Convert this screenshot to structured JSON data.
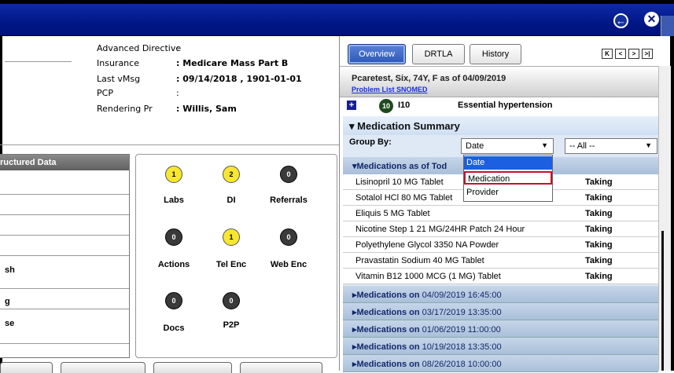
{
  "titlebar": {
    "back_icon": "back-arrow-icon",
    "close_icon": "close-icon",
    "back_glyph": "←",
    "close_glyph": "✕"
  },
  "patient_info": {
    "advanced_directive_label": "Advanced Directive",
    "advanced_directive_value": ":",
    "insurance_label": "Insurance",
    "insurance_value": ": Medicare Mass Part B",
    "last_vmsg_label": "Last vMsg",
    "last_vmsg_value": ": 09/14/2018 , 1901-01-01",
    "pcp_label": "PCP",
    "pcp_value": ":",
    "rendering_pr_label": "Rendering Pr",
    "rendering_pr_value": ": Willis, Sam"
  },
  "structured_data": {
    "header": "ructured Data",
    "rows": [
      "sh",
      "g",
      "se"
    ]
  },
  "icon_grid": {
    "items": [
      {
        "label": "Labs",
        "count": "1",
        "color": "yellow"
      },
      {
        "label": "DI",
        "count": "2",
        "color": "yellow"
      },
      {
        "label": "Referrals",
        "count": "0",
        "color": "dark"
      },
      {
        "label": "Actions",
        "count": "0",
        "color": "dark"
      },
      {
        "label": "Tel Enc",
        "count": "1",
        "color": "yellow"
      },
      {
        "label": "Web Enc",
        "count": "0",
        "color": "dark"
      },
      {
        "label": "Docs",
        "count": "0",
        "color": "dark"
      },
      {
        "label": "P2P",
        "count": "0",
        "color": "dark"
      }
    ]
  },
  "right_panel": {
    "tabs": [
      "Overview",
      "DRTLA",
      "History"
    ],
    "nav_buttons": [
      "K",
      "<",
      ">",
      ">|"
    ],
    "patient_line": "Pcaretest, Six, 74Y, F as of 04/09/2019",
    "problem_list_link": "Problem List SNOMED",
    "problem": {
      "badge": "10",
      "code": "I10",
      "description": "Essential hypertension"
    },
    "med_summary_title": "▾ Medication Summary",
    "group_by_label": "Group By:",
    "group_by_value": "Date",
    "filter_value": "-- All --",
    "meds_as_of": "▾Medications as of Tod",
    "medications": [
      {
        "name": "Lisinopril 10 MG Tablet",
        "status": "Taking"
      },
      {
        "name": "Sotalol HCl 80 MG Tablet",
        "status": "Taking"
      },
      {
        "name": "Eliquis 5 MG Tablet",
        "status": "Taking"
      },
      {
        "name": "Nicotine Step 1 21 MG/24HR Patch 24 Hour",
        "status": "Taking"
      },
      {
        "name": "Polyethylene Glycol 3350 NA Powder",
        "status": "Taking"
      },
      {
        "name": "Pravastatin Sodium 40 MG Tablet",
        "status": "Taking"
      },
      {
        "name": "Vitamin B12 1000 MCG (1 MG) Tablet",
        "status": "Taking"
      }
    ],
    "history_prefix": "▸Medications on",
    "history": [
      "04/09/2019 16:45:00",
      "03/17/2019 13:35:00",
      "01/06/2019 11:00:00",
      "10/19/2018 13:35:00",
      "08/26/2018 10:00:00"
    ]
  },
  "dropdown": {
    "options": [
      "Date",
      "Medication",
      "Provider"
    ],
    "highlighted": "Date",
    "outlined": "Medication"
  },
  "colors": {
    "titlebar": "#00117a",
    "tab_active": "#2c57b8",
    "badge_yellow": "#f7e72e",
    "badge_dark": "#3a3a3a",
    "highlight_outline": "#c8102e",
    "link": "#1a2ee8"
  }
}
